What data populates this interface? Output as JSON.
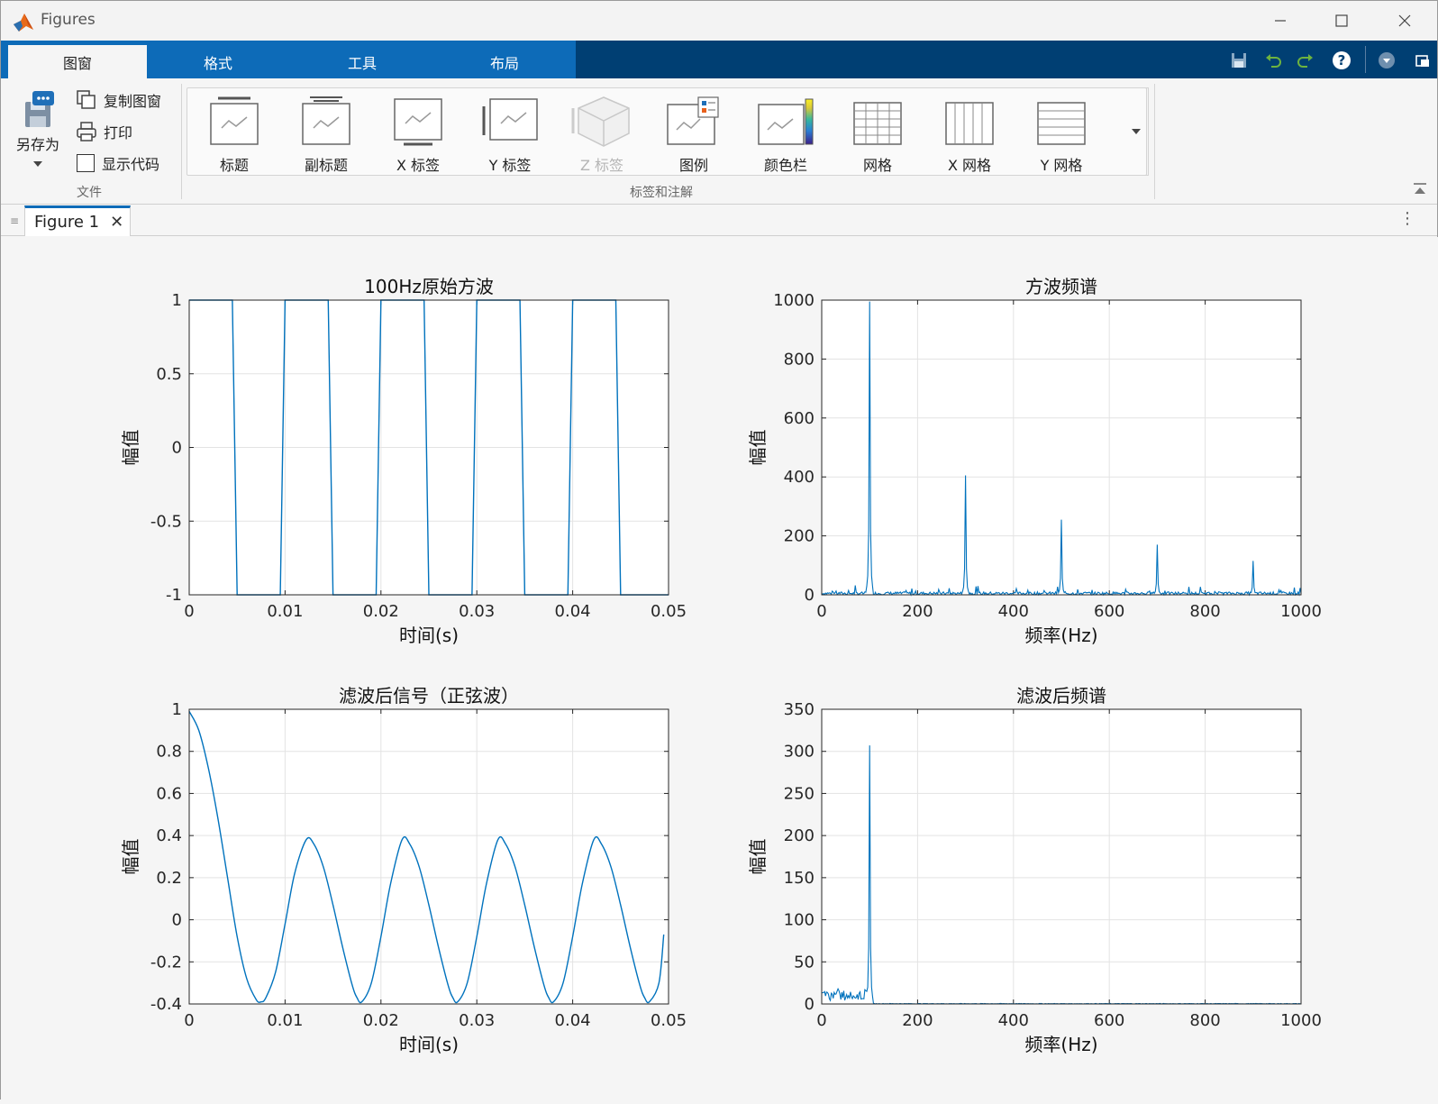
{
  "window": {
    "title": "Figures"
  },
  "tabs": [
    {
      "label": "图窗",
      "active": true
    },
    {
      "label": "格式"
    },
    {
      "label": "工具"
    },
    {
      "label": "布局"
    }
  ],
  "file_group": {
    "label": "文件",
    "save_as": "另存为",
    "copy_figure": "复制图窗",
    "print": "打印",
    "show_code": "显示代码"
  },
  "annotation_group": {
    "label": "标签和注解",
    "buttons": [
      "标题",
      "副标题",
      "X 标签",
      "Y 标签",
      "Z 标签",
      "图例",
      "颜色栏",
      "网格",
      "X 网格",
      "Y 网格"
    ]
  },
  "doc_tab": {
    "label": "Figure 1"
  },
  "chart_data": [
    {
      "type": "line",
      "title": "100Hz原始方波",
      "xlabel": "时间(s)",
      "ylabel": "幅值",
      "xlim": [
        0,
        0.05
      ],
      "ylim": [
        -1,
        1
      ],
      "xticks": [
        0,
        0.01,
        0.02,
        0.03,
        0.04,
        0.05
      ],
      "xtick_labels": [
        "0",
        "0.01",
        "0.02",
        "0.03",
        "0.04",
        "0.05"
      ],
      "yticks": [
        -1,
        -0.5,
        0,
        0.5,
        1
      ],
      "ytick_labels": [
        "-1",
        "-0.5",
        "0",
        "0.5",
        "1"
      ],
      "grid": true,
      "x": [
        0,
        0.0045,
        0.005,
        0.0095,
        0.01,
        0.0145,
        0.015,
        0.0195,
        0.02,
        0.0245,
        0.025,
        0.0295,
        0.03,
        0.0345,
        0.035,
        0.0395,
        0.04,
        0.0445,
        0.045,
        0.05
      ],
      "y": [
        1,
        1,
        -1,
        -1,
        1,
        1,
        -1,
        -1,
        1,
        1,
        -1,
        -1,
        1,
        1,
        -1,
        -1,
        1,
        1,
        -1,
        -1
      ]
    },
    {
      "type": "line",
      "title": "方波频谱",
      "xlabel": "频率(Hz)",
      "ylabel": "幅值",
      "xlim": [
        0,
        1000
      ],
      "ylim": [
        0,
        1000
      ],
      "xticks": [
        0,
        200,
        400,
        600,
        800,
        1000
      ],
      "xtick_labels": [
        "0",
        "200",
        "400",
        "600",
        "800",
        "1000"
      ],
      "yticks": [
        0,
        200,
        400,
        600,
        800,
        1000
      ],
      "ytick_labels": [
        "0",
        "200",
        "400",
        "600",
        "800",
        "1000"
      ],
      "grid": true,
      "peaks": [
        {
          "x": 100,
          "y": 995
        },
        {
          "x": 300,
          "y": 405
        },
        {
          "x": 500,
          "y": 255
        },
        {
          "x": 700,
          "y": 170
        },
        {
          "x": 900,
          "y": 115
        }
      ],
      "noise_level": 10
    },
    {
      "type": "line",
      "title": "滤波后信号（正弦波）",
      "xlabel": "时间(s)",
      "ylabel": "幅值",
      "xlim": [
        0,
        0.05
      ],
      "ylim": [
        -0.4,
        1
      ],
      "xticks": [
        0,
        0.01,
        0.02,
        0.03,
        0.04,
        0.05
      ],
      "xtick_labels": [
        "0",
        "0.01",
        "0.02",
        "0.03",
        "0.04",
        "0.05"
      ],
      "yticks": [
        -0.4,
        -0.2,
        0,
        0.2,
        0.4,
        0.6,
        0.8,
        1
      ],
      "ytick_labels": [
        "-0.4",
        "-0.2",
        "0",
        "0.2",
        "0.4",
        "0.6",
        "0.8",
        "1"
      ],
      "grid": true,
      "x": [
        0,
        0.001,
        0.002,
        0.003,
        0.004,
        0.005,
        0.006,
        0.007,
        0.0075,
        0.008,
        0.009,
        0.01,
        0.011,
        0.0122,
        0.013,
        0.014,
        0.015,
        0.016,
        0.017,
        0.0175,
        0.018,
        0.019,
        0.02,
        0.021,
        0.0222,
        0.023,
        0.024,
        0.025,
        0.026,
        0.027,
        0.0275,
        0.028,
        0.029,
        0.03,
        0.031,
        0.0322,
        0.033,
        0.034,
        0.035,
        0.036,
        0.037,
        0.0375,
        0.038,
        0.039,
        0.04,
        0.041,
        0.0422,
        0.043,
        0.044,
        0.045,
        0.046,
        0.047,
        0.0475,
        0.048,
        0.049,
        0.0495
      ],
      "y": [
        0.99,
        0.9,
        0.72,
        0.48,
        0.2,
        -0.08,
        -0.28,
        -0.38,
        -0.39,
        -0.37,
        -0.25,
        -0.02,
        0.22,
        0.38,
        0.36,
        0.25,
        0.07,
        -0.13,
        -0.31,
        -0.37,
        -0.39,
        -0.3,
        -0.08,
        0.17,
        0.38,
        0.36,
        0.25,
        0.07,
        -0.13,
        -0.31,
        -0.37,
        -0.39,
        -0.3,
        -0.08,
        0.17,
        0.38,
        0.36,
        0.25,
        0.07,
        -0.13,
        -0.31,
        -0.37,
        -0.39,
        -0.3,
        -0.08,
        0.17,
        0.38,
        0.36,
        0.25,
        0.07,
        -0.13,
        -0.31,
        -0.37,
        -0.39,
        -0.3,
        -0.07
      ]
    },
    {
      "type": "line",
      "title": "滤波后频谱",
      "xlabel": "频率(Hz)",
      "ylabel": "幅值",
      "xlim": [
        0,
        1000
      ],
      "ylim": [
        0,
        350
      ],
      "xticks": [
        0,
        200,
        400,
        600,
        800,
        1000
      ],
      "xtick_labels": [
        "0",
        "200",
        "400",
        "600",
        "800",
        "1000"
      ],
      "yticks": [
        0,
        50,
        100,
        150,
        200,
        250,
        300,
        350
      ],
      "ytick_labels": [
        "0",
        "50",
        "100",
        "150",
        "200",
        "250",
        "300",
        "350"
      ],
      "grid": true,
      "peaks": [
        {
          "x": 100,
          "y": 307
        }
      ],
      "low_band": {
        "x_max": 100,
        "level": 12
      }
    }
  ]
}
